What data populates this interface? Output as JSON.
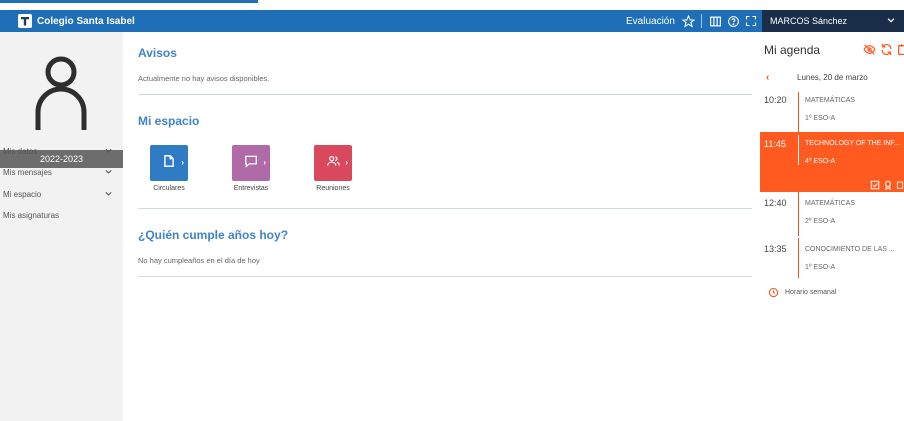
{
  "header": {
    "brand": "Colegio Santa Isabel",
    "evaluation_label": "Evaluación",
    "user_name": "MARCOS Sánchez",
    "accent_color": "#1e6fb8"
  },
  "sidebar": {
    "year": "2022-2023",
    "items": [
      {
        "label": "Mis datos",
        "has_submenu": true
      },
      {
        "label": "Mis mensajes",
        "has_submenu": true
      },
      {
        "label": "Mi espacio",
        "has_submenu": true
      },
      {
        "label": "Mis asignaturas",
        "has_submenu": false
      }
    ]
  },
  "main": {
    "notices": {
      "title": "Avisos",
      "empty_text": "Actualmente no hay avisos disponibles."
    },
    "my_space": {
      "title": "Mi espacio",
      "tiles": [
        {
          "label": "Circulares",
          "icon": "document-icon",
          "color": "#2f7bc4"
        },
        {
          "label": "Entrevistas",
          "icon": "chat-icon",
          "color": "#b06aa8"
        },
        {
          "label": "Reuniones",
          "icon": "people-icon",
          "color": "#d9485c"
        }
      ]
    },
    "birthdays": {
      "title": "¿Quién cumple años hoy?",
      "empty_text": "No hay cumpleaños en el día de hoy"
    }
  },
  "agenda": {
    "title": "Mi agenda",
    "date": "Lunes, 20 de marzo",
    "accent_color": "#ff5a1f",
    "slots": [
      {
        "time": "10:20",
        "subject": "MATEMÁTICAS",
        "group": "1º ESO-A",
        "active": false
      },
      {
        "time": "11:45",
        "subject": "TECHNOLOGY OF THE INF...",
        "group": "4º ESO-A",
        "active": true
      },
      {
        "time": "12:40",
        "subject": "MATEMÁTICAS",
        "group": "2º ESO-A",
        "active": false
      },
      {
        "time": "13:35",
        "subject": "CONOCIMIENTO DE LAS ...",
        "group": "1º ESO-A",
        "active": false
      }
    ],
    "weekly_link": "Horario semanal"
  }
}
